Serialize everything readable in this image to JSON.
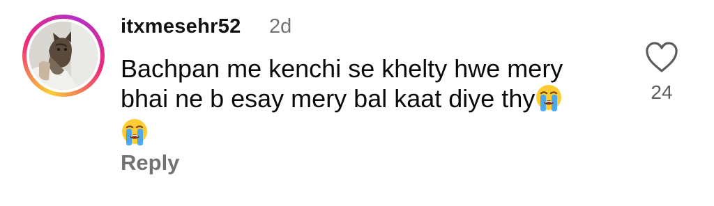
{
  "comment": {
    "username": "itxmesehr52",
    "time_ago": "2d",
    "text_line1": "Bachpan me kenchi se khelty hwe mery",
    "text_line2": "bhai ne b esay mery bal kaat diye thy",
    "emoji": "loudly-crying-face",
    "reply_label": "Reply",
    "like_count": "24",
    "like_icon": "heart-outline-icon"
  },
  "colors": {
    "text_primary": "#0a0a0a",
    "text_secondary": "#737373",
    "story_ring": [
      "#f9ce34",
      "#ee2a7b",
      "#b52fc7"
    ]
  }
}
